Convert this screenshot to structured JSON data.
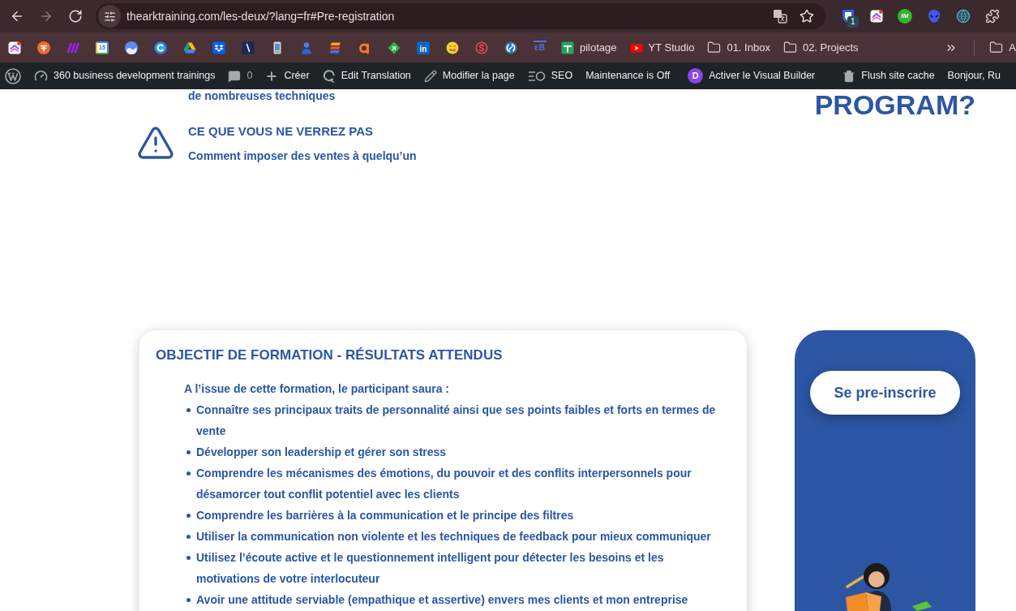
{
  "browser": {
    "nav_buttons": [
      {
        "kind": "back",
        "disabled": false
      },
      {
        "kind": "forward",
        "disabled": true
      },
      {
        "kind": "reload",
        "disabled": false
      }
    ],
    "url": "thearktraining.com/les-deux/?lang=fr#Pre-registration",
    "bookmarked": false,
    "extensions": [
      {
        "kind": "shield",
        "badge": "1"
      },
      {
        "kind": "chevron-tile"
      },
      {
        "kind": "round-text",
        "glyph": "IM"
      },
      {
        "kind": "alien"
      },
      {
        "kind": "web"
      },
      {
        "kind": "puzzle"
      }
    ]
  },
  "bookmarks": {
    "items": [
      {
        "kind": "chevron-tile"
      },
      {
        "kind": "coin"
      },
      {
        "kind": "strokes"
      },
      {
        "kind": "calendar",
        "glyph": "15"
      },
      {
        "kind": "cloud"
      },
      {
        "kind": "ring-arc"
      },
      {
        "kind": "drive"
      },
      {
        "kind": "dropbox"
      },
      {
        "kind": "slash-tile"
      },
      {
        "kind": "phone"
      },
      {
        "kind": "person"
      },
      {
        "kind": "stripes"
      },
      {
        "kind": "hook"
      },
      {
        "kind": "diamond"
      },
      {
        "kind": "tile-text",
        "glyph": "in"
      },
      {
        "kind": "smiley"
      },
      {
        "kind": "s-ring"
      },
      {
        "kind": "ring-dot"
      },
      {
        "kind": "bar-text",
        "glyph": "ɛB"
      },
      {
        "kind": "sheet",
        "label": "pilotage"
      },
      {
        "kind": "play",
        "label": "YT Studio"
      },
      {
        "kind": "folder",
        "label": "01. Inbox"
      },
      {
        "kind": "folder",
        "label": "02. Projects"
      }
    ],
    "other": {
      "kind": "folder",
      "label": "A"
    }
  },
  "admin_bar": {
    "items": [
      {
        "kind": "logo"
      },
      {
        "kind": "dashboard",
        "label": "360 business development trainings"
      },
      {
        "kind": "comments",
        "label": "0"
      },
      {
        "kind": "new",
        "label": "Créer"
      },
      {
        "kind": "translate",
        "label": "Edit Translation"
      },
      {
        "kind": "edit",
        "label": "Modifier la page"
      },
      {
        "kind": "seo",
        "label": "SEO"
      },
      {
        "kind": "text",
        "label": "Maintenance is Off"
      },
      {
        "kind": "builder",
        "glyph": "D",
        "label": "Activer le Visual Builder"
      },
      {
        "kind": "cache",
        "label": "Flush site cache"
      },
      {
        "kind": "text",
        "label": "Bonjour, Ru"
      }
    ]
  },
  "page": {
    "intro_tail": "de nombreuses techniques",
    "warning": {
      "heading": "CE QUE VOUS NE VERREZ PAS",
      "text": "Comment imposer des ventes à quelqu’un"
    },
    "side_heading": "PROGRAM?",
    "objectives": {
      "heading": "OBJECTIF DE FORMATION - RÉSULTATS ATTENDUS",
      "intro": "A l’issue de cette formation, le participant saura :",
      "items": [
        "Connaître ses principaux traits de personnalité ainsi que ses points faibles et forts en termes de vente",
        "Développer son leadership et gérer son stress",
        "Comprendre les mécanismes des émotions, du pouvoir et des conflits interpersonnels pour désamorcer tout conflit potentiel avec les clients",
        "Comprendre les barrières à la communication et le principe des filtres",
        "Utiliser la communication non violente et les techniques de feedback pour mieux communiquer",
        "Utilisez l’écoute active et le questionnement intelligent pour détecter les besoins et les motivations de votre interlocuteur",
        "Avoir une attitude serviable (empathique et assertive) envers mes clients et mon entreprise"
      ]
    },
    "cta": {
      "label": "Se pre-inscrire"
    }
  }
}
